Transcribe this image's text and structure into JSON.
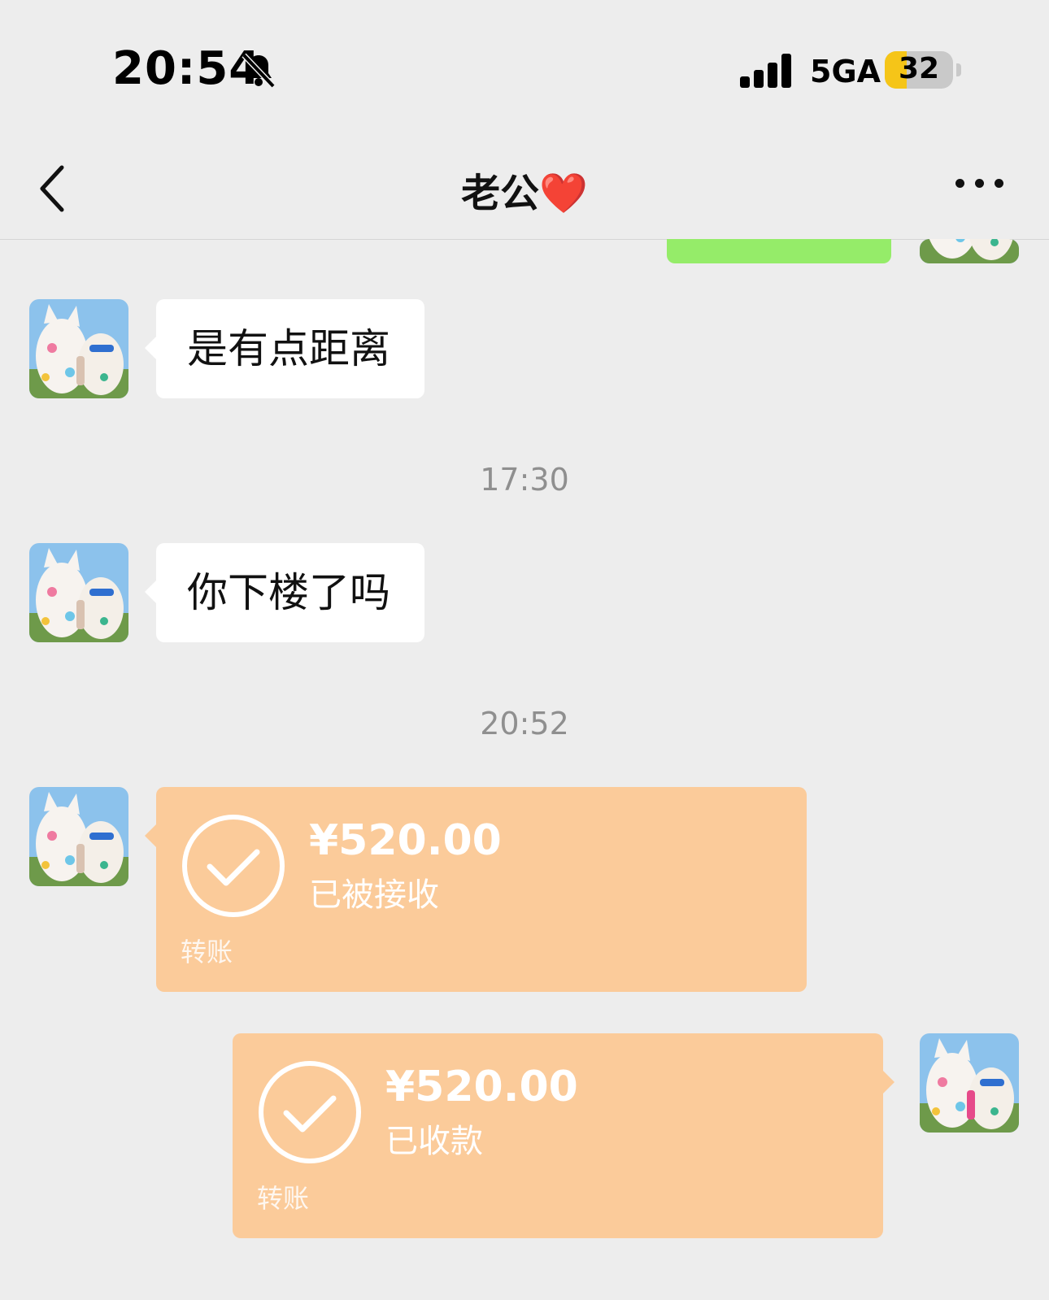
{
  "status_bar": {
    "time": "20:54",
    "network": "5GA",
    "battery": "32",
    "battery_level": 0.32,
    "icons": [
      "bell-slash-icon",
      "signal-icon",
      "battery-icon"
    ]
  },
  "nav": {
    "title": "老公",
    "title_emoji": "❤️",
    "icons": [
      "chevron-left-icon",
      "more-icon"
    ]
  },
  "messages": [
    {
      "type": "text",
      "side": "left",
      "text": "是有点距离"
    },
    {
      "type": "timestamp",
      "text": "17:30"
    },
    {
      "type": "text",
      "side": "left",
      "text": "你下楼了吗"
    },
    {
      "type": "timestamp",
      "text": "20:52"
    },
    {
      "type": "transfer",
      "side": "left",
      "amount": "¥520.00",
      "status": "已被接收",
      "label": "转账"
    },
    {
      "type": "transfer",
      "side": "right",
      "amount": "¥520.00",
      "status": "已收款",
      "label": "转账"
    }
  ],
  "colors": {
    "background": "#ededed",
    "outgoing_bubble": "#95ec69",
    "incoming_bubble": "#ffffff",
    "transfer_card": "#fbcb9a",
    "timestamp": "#8f8f8f",
    "heart": "#e0141e"
  }
}
